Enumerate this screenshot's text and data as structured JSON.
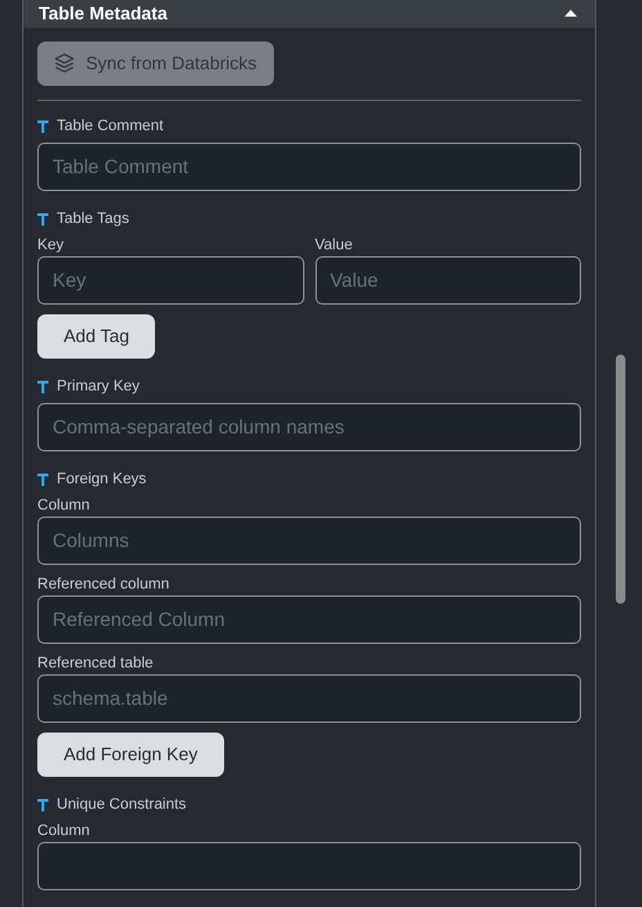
{
  "panel": {
    "title": "Table Metadata",
    "expanded": true
  },
  "sync_button": {
    "label": "Sync from Databricks",
    "disabled": true
  },
  "sections": [
    {
      "label": "Table Comment",
      "rows": [
        {
          "kind": "fields",
          "fields": [
            {
              "placeholder": "Table Comment"
            }
          ]
        }
      ]
    },
    {
      "label": "Table Tags",
      "rows": [
        {
          "kind": "fields",
          "fields": [
            {
              "label": "Key",
              "placeholder": "Key"
            },
            {
              "label": "Value",
              "placeholder": "Value"
            }
          ]
        },
        {
          "kind": "button",
          "label": "Add Tag"
        }
      ]
    },
    {
      "label": "Primary Key",
      "rows": [
        {
          "kind": "fields",
          "fields": [
            {
              "placeholder": "Comma-separated column names"
            }
          ]
        }
      ]
    },
    {
      "label": "Foreign Keys",
      "rows": [
        {
          "kind": "fields",
          "fields": [
            {
              "label": "Column",
              "placeholder": "Columns"
            }
          ]
        },
        {
          "kind": "fields",
          "fields": [
            {
              "label": "Referenced column",
              "placeholder": "Referenced Column"
            }
          ]
        },
        {
          "kind": "fields",
          "fields": [
            {
              "label": "Referenced table",
              "placeholder": "schema.table"
            }
          ]
        },
        {
          "kind": "button",
          "label": "Add Foreign Key"
        }
      ]
    },
    {
      "label": "Unique Constraints",
      "rows": [
        {
          "kind": "fields",
          "fields": [
            {
              "label": "Column"
            }
          ]
        }
      ]
    }
  ]
}
